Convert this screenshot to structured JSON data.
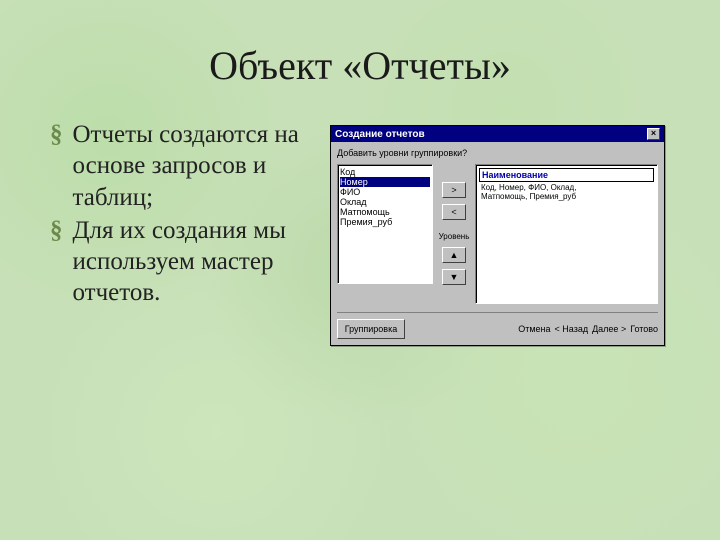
{
  "slide": {
    "title": "Объект «Отчеты»",
    "bullets": [
      "Отчеты создаются на основе запросов и таблиц;",
      "Для их создания мы используем мастер отчетов."
    ]
  },
  "dialog": {
    "title": "Создание отчетов",
    "close": "×",
    "prompt": "Добавить уровни группировки?",
    "list": {
      "items": [
        "Код",
        "Номер",
        "ФИО",
        "Оклад",
        "Матпомощь",
        "Премия_руб"
      ],
      "selected": "Номер"
    },
    "buttons": {
      "add": ">",
      "remove": "<",
      "priority_label": "Уровень",
      "up": "▲",
      "down": "▼"
    },
    "preview": {
      "header": "Наименование",
      "line1": "Код, Номер, ФИО, Оклад,",
      "line2": "Матпомощь, Премия_руб"
    },
    "footer": {
      "grouping": "Группировка",
      "cancel": "Отмена",
      "back": "< Назад",
      "next": "Далее >",
      "finish": "Готово"
    }
  }
}
